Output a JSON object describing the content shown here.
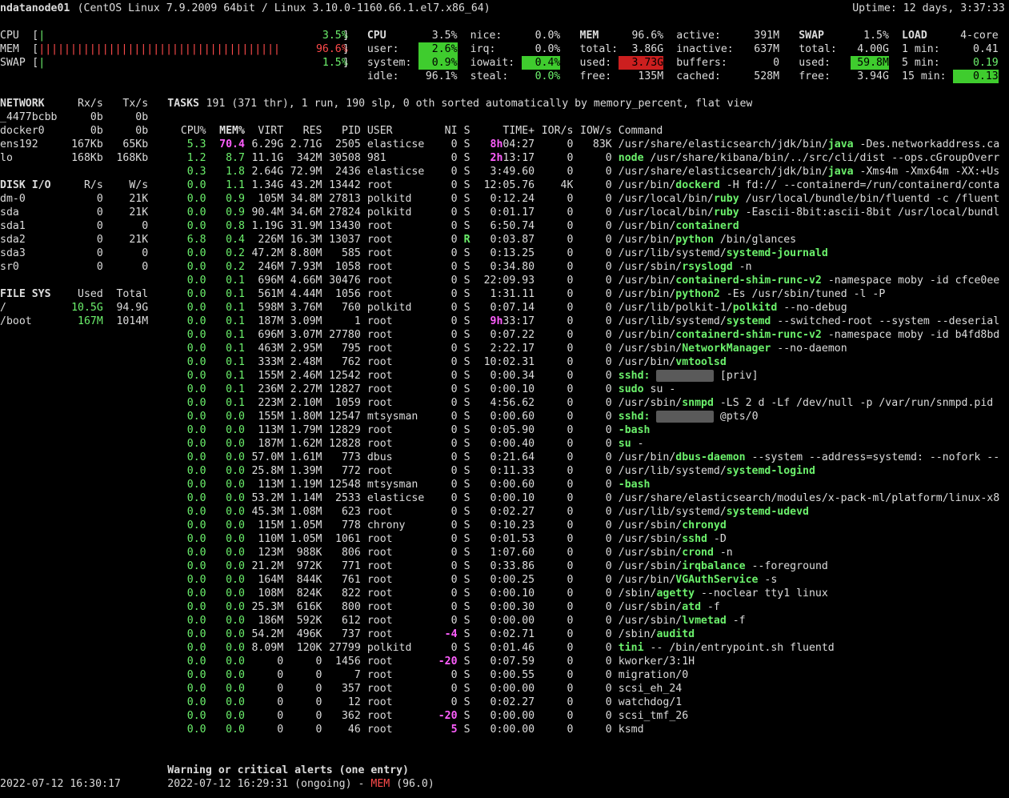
{
  "header": {
    "hostname": "ndatanode01",
    "system": "(CentOS Linux 7.9.2009 64bit / Linux 3.10.0-1160.66.1.el7.x86_64)",
    "uptime": "Uptime: 12 days, 3:37:33"
  },
  "quicklook": {
    "cpu": {
      "label": "CPU",
      "bar": "|",
      "value": "3.5%",
      "percent": 3.5
    },
    "mem": {
      "label": "MEM",
      "bar": "||||||||||||||||||||||||||||||||||||||",
      "value": "96.6%",
      "percent": 96.6
    },
    "swap": {
      "label": "SWAP",
      "bar": "|",
      "value": "1.5%",
      "percent": 1.5
    }
  },
  "cpu": {
    "title": "CPU",
    "total": "3.5%",
    "user_label": "user:",
    "user": "2.6%",
    "system_label": "system:",
    "system": "0.9%",
    "idle_label": "idle:",
    "idle": "96.1%",
    "nice_label": "nice:",
    "nice": "0.0%",
    "irq_label": "irq:",
    "irq": "0.0%",
    "iowait_label": "iowait:",
    "iowait": "0.4%",
    "steal_label": "steal:",
    "steal": "0.0%"
  },
  "mem": {
    "title": "MEM",
    "percent": "96.6%",
    "total_label": "total:",
    "total": "3.86G",
    "used_label": "used:",
    "used": "3.73G",
    "free_label": "free:",
    "free": "135M",
    "active_label": "active:",
    "active": "391M",
    "inactive_label": "inactive:",
    "inactive": "637M",
    "buffers_label": "buffers:",
    "buffers": "0",
    "cached_label": "cached:",
    "cached": "528M"
  },
  "swap": {
    "title": "SWAP",
    "percent": "1.5%",
    "total_label": "total:",
    "total": "4.00G",
    "used_label": "used:",
    "used": "59.8M",
    "free_label": "free:",
    "free": "3.94G"
  },
  "load": {
    "title": "LOAD",
    "cores": "4-core",
    "l1_label": "1 min:",
    "l1": "0.41",
    "l5_label": "5 min:",
    "l5": "0.19",
    "l15_label": "15 min:",
    "l15": "0.13"
  },
  "network": {
    "title": "NETWORK",
    "rx_header": "Rx/s",
    "tx_header": "Tx/s",
    "rows": [
      {
        "name": "_4477bcbb",
        "rx": "0b",
        "tx": "0b"
      },
      {
        "name": "docker0",
        "rx": "0b",
        "tx": "0b"
      },
      {
        "name": "ens192",
        "rx": "167Kb",
        "tx": "65Kb"
      },
      {
        "name": "lo",
        "rx": "168Kb",
        "tx": "168Kb"
      }
    ]
  },
  "diskio": {
    "title": "DISK I/O",
    "r_header": "R/s",
    "w_header": "W/s",
    "rows": [
      {
        "name": "dm-0",
        "r": "0",
        "w": "21K"
      },
      {
        "name": "sda",
        "r": "0",
        "w": "21K"
      },
      {
        "name": "sda1",
        "r": "0",
        "w": "0"
      },
      {
        "name": "sda2",
        "r": "0",
        "w": "21K"
      },
      {
        "name": "sda3",
        "r": "0",
        "w": "0"
      },
      {
        "name": "sr0",
        "r": "0",
        "w": "0"
      }
    ]
  },
  "fs": {
    "title": "FILE SYS",
    "used_header": "Used",
    "total_header": "Total",
    "rows": [
      {
        "name": "/",
        "used": "10.5G",
        "total": "94.9G"
      },
      {
        "name": "/boot",
        "used": "167M",
        "total": "1014M"
      }
    ]
  },
  "tasks": {
    "title": "TASKS",
    "summary": "191 (371 thr), 1 run, 190 slp, 0 oth sorted automatically by memory_percent, flat view"
  },
  "proc_headers": {
    "cpu": "CPU%",
    "mem": "MEM%",
    "virt": "VIRT",
    "res": "RES",
    "pid": "PID",
    "user": "USER",
    "ni": "NI",
    "s": "S",
    "time": "TIME+",
    "ior": "IOR/s",
    "iow": "IOW/s",
    "cmd": "Command"
  },
  "processes": [
    {
      "cpu": "5.3",
      "mem": "70.4",
      "virt": "6.29G",
      "res": "2.71G",
      "pid": "2505",
      "user": "elasticse",
      "ni": "0",
      "s": "S",
      "time_hi": "8h",
      "time": "04:27",
      "ior": "0",
      "iow": "83K",
      "cmd_pre": "/usr/share/elasticsearch/jdk/bin/",
      "cmd_hl": "java",
      "cmd_post": " -Des.networkaddress.ca"
    },
    {
      "cpu": "1.2",
      "mem": "8.7",
      "virt": "11.1G",
      "res": "342M",
      "pid": "30508",
      "user": "981",
      "ni": "0",
      "s": "S",
      "time_hi": "2h",
      "time": "13:17",
      "ior": "0",
      "iow": "0",
      "cmd_pre": "",
      "cmd_hl": "node",
      "cmd_post": " /usr/share/kibana/bin/../src/cli/dist --ops.cGroupOverr"
    },
    {
      "cpu": "0.3",
      "mem": "1.8",
      "virt": "2.64G",
      "res": "72.9M",
      "pid": "2436",
      "user": "elasticse",
      "ni": "0",
      "s": "S",
      "time_hi": "",
      "time": "3:49.60",
      "ior": "0",
      "iow": "0",
      "cmd_pre": "/usr/share/elasticsearch/jdk/bin/",
      "cmd_hl": "java",
      "cmd_post": " -Xms4m -Xmx64m -XX:+Us"
    },
    {
      "cpu": "0.0",
      "mem": "1.1",
      "virt": "1.34G",
      "res": "43.2M",
      "pid": "13442",
      "user": "root",
      "ni": "0",
      "s": "S",
      "time_hi": "",
      "time": "12:05.76",
      "ior": "4K",
      "iow": "0",
      "cmd_pre": "/usr/bin/",
      "cmd_hl": "dockerd",
      "cmd_post": " -H fd:// --containerd=/run/containerd/conta"
    },
    {
      "cpu": "0.0",
      "mem": "0.9",
      "virt": "105M",
      "res": "34.8M",
      "pid": "27813",
      "user": "polkitd",
      "ni": "0",
      "s": "S",
      "time_hi": "",
      "time": "0:12.24",
      "ior": "0",
      "iow": "0",
      "cmd_pre": "/usr/local/bin/",
      "cmd_hl": "ruby",
      "cmd_post": " /usr/local/bundle/bin/fluentd -c /fluent"
    },
    {
      "cpu": "0.0",
      "mem": "0.9",
      "virt": "90.4M",
      "res": "34.6M",
      "pid": "27824",
      "user": "polkitd",
      "ni": "0",
      "s": "S",
      "time_hi": "",
      "time": "0:01.17",
      "ior": "0",
      "iow": "0",
      "cmd_pre": "/usr/local/bin/",
      "cmd_hl": "ruby",
      "cmd_post": " -Eascii-8bit:ascii-8bit /usr/local/bundl"
    },
    {
      "cpu": "0.0",
      "mem": "0.8",
      "virt": "1.19G",
      "res": "31.9M",
      "pid": "13430",
      "user": "root",
      "ni": "0",
      "s": "S",
      "time_hi": "",
      "time": "6:50.74",
      "ior": "0",
      "iow": "0",
      "cmd_pre": "/usr/bin/",
      "cmd_hl": "containerd",
      "cmd_post": ""
    },
    {
      "cpu": "6.8",
      "mem": "0.4",
      "virt": "226M",
      "res": "16.3M",
      "pid": "13037",
      "user": "root",
      "ni": "0",
      "s": "R",
      "time_hi": "",
      "time": "0:03.87",
      "ior": "0",
      "iow": "0",
      "cmd_pre": "/usr/bin/",
      "cmd_hl": "python",
      "cmd_post": " /bin/glances"
    },
    {
      "cpu": "0.0",
      "mem": "0.2",
      "virt": "47.2M",
      "res": "8.80M",
      "pid": "585",
      "user": "root",
      "ni": "0",
      "s": "S",
      "time_hi": "",
      "time": "0:13.25",
      "ior": "0",
      "iow": "0",
      "cmd_pre": "/usr/lib/systemd/",
      "cmd_hl": "systemd-journald",
      "cmd_post": ""
    },
    {
      "cpu": "0.0",
      "mem": "0.2",
      "virt": "246M",
      "res": "7.93M",
      "pid": "1058",
      "user": "root",
      "ni": "0",
      "s": "S",
      "time_hi": "",
      "time": "0:34.80",
      "ior": "0",
      "iow": "0",
      "cmd_pre": "/usr/sbin/",
      "cmd_hl": "rsyslogd",
      "cmd_post": " -n"
    },
    {
      "cpu": "0.0",
      "mem": "0.1",
      "virt": "696M",
      "res": "4.66M",
      "pid": "30476",
      "user": "root",
      "ni": "0",
      "s": "S",
      "time_hi": "",
      "time": "22:09.93",
      "ior": "0",
      "iow": "0",
      "cmd_pre": "/usr/bin/",
      "cmd_hl": "containerd-shim-runc-v2",
      "cmd_post": " -namespace moby -id cfce0ee"
    },
    {
      "cpu": "0.0",
      "mem": "0.1",
      "virt": "561M",
      "res": "4.44M",
      "pid": "1056",
      "user": "root",
      "ni": "0",
      "s": "S",
      "time_hi": "",
      "time": "1:31.11",
      "ior": "0",
      "iow": "0",
      "cmd_pre": "/usr/bin/",
      "cmd_hl": "python2",
      "cmd_post": " -Es /usr/sbin/tuned -l -P"
    },
    {
      "cpu": "0.0",
      "mem": "0.1",
      "virt": "598M",
      "res": "3.76M",
      "pid": "760",
      "user": "polkitd",
      "ni": "0",
      "s": "S",
      "time_hi": "",
      "time": "0:07.14",
      "ior": "0",
      "iow": "0",
      "cmd_pre": "/usr/lib/polkit-1/",
      "cmd_hl": "polkitd",
      "cmd_post": " --no-debug"
    },
    {
      "cpu": "0.0",
      "mem": "0.1",
      "virt": "187M",
      "res": "3.09M",
      "pid": "1",
      "user": "root",
      "ni": "0",
      "s": "S",
      "time_hi": "9h",
      "time": "33:17",
      "ior": "0",
      "iow": "0",
      "cmd_pre": "/usr/lib/systemd/",
      "cmd_hl": "systemd",
      "cmd_post": " --switched-root --system --deserial"
    },
    {
      "cpu": "0.0",
      "mem": "0.1",
      "virt": "696M",
      "res": "3.07M",
      "pid": "27780",
      "user": "root",
      "ni": "0",
      "s": "S",
      "time_hi": "",
      "time": "0:07.22",
      "ior": "0",
      "iow": "0",
      "cmd_pre": "/usr/bin/",
      "cmd_hl": "containerd-shim-runc-v2",
      "cmd_post": " -namespace moby -id b4fd8bd"
    },
    {
      "cpu": "0.0",
      "mem": "0.1",
      "virt": "463M",
      "res": "2.95M",
      "pid": "795",
      "user": "root",
      "ni": "0",
      "s": "S",
      "time_hi": "",
      "time": "2:22.17",
      "ior": "0",
      "iow": "0",
      "cmd_pre": "/usr/sbin/",
      "cmd_hl": "NetworkManager",
      "cmd_post": " --no-daemon"
    },
    {
      "cpu": "0.0",
      "mem": "0.1",
      "virt": "333M",
      "res": "2.48M",
      "pid": "762",
      "user": "root",
      "ni": "0",
      "s": "S",
      "time_hi": "",
      "time": "10:02.31",
      "ior": "0",
      "iow": "0",
      "cmd_pre": "/usr/bin/",
      "cmd_hl": "vmtoolsd",
      "cmd_post": ""
    },
    {
      "cpu": "0.0",
      "mem": "0.1",
      "virt": "155M",
      "res": "2.46M",
      "pid": "12542",
      "user": "root",
      "ni": "0",
      "s": "S",
      "time_hi": "",
      "time": "0:00.34",
      "ior": "0",
      "iow": "0",
      "cmd_pre": "",
      "cmd_hl": "sshd:",
      "cmd_blur": "xxxxxxxxx",
      "cmd_post": "[priv]"
    },
    {
      "cpu": "0.0",
      "mem": "0.1",
      "virt": "236M",
      "res": "2.27M",
      "pid": "12827",
      "user": "root",
      "ni": "0",
      "s": "S",
      "time_hi": "",
      "time": "0:00.10",
      "ior": "0",
      "iow": "0",
      "cmd_pre": "",
      "cmd_hl": "sudo",
      "cmd_post": " su -"
    },
    {
      "cpu": "0.0",
      "mem": "0.1",
      "virt": "223M",
      "res": "2.10M",
      "pid": "1059",
      "user": "root",
      "ni": "0",
      "s": "S",
      "time_hi": "",
      "time": "4:56.62",
      "ior": "0",
      "iow": "0",
      "cmd_pre": "/usr/sbin/",
      "cmd_hl": "snmpd",
      "cmd_post": " -LS 2 d -Lf /dev/null -p /var/run/snmpd.pid"
    },
    {
      "cpu": "0.0",
      "mem": "0.0",
      "virt": "155M",
      "res": "1.80M",
      "pid": "12547",
      "user": "mtsysman",
      "ni": "0",
      "s": "S",
      "time_hi": "",
      "time": "0:00.60",
      "ior": "0",
      "iow": "0",
      "cmd_pre": "",
      "cmd_hl": "sshd:",
      "cmd_blur": "xxxxxxxxx",
      "cmd_post": "@pts/0"
    },
    {
      "cpu": "0.0",
      "mem": "0.0",
      "virt": "113M",
      "res": "1.79M",
      "pid": "12829",
      "user": "root",
      "ni": "0",
      "s": "S",
      "time_hi": "",
      "time": "0:05.90",
      "ior": "0",
      "iow": "0",
      "cmd_pre": "",
      "cmd_hl": "-bash",
      "cmd_post": ""
    },
    {
      "cpu": "0.0",
      "mem": "0.0",
      "virt": "187M",
      "res": "1.62M",
      "pid": "12828",
      "user": "root",
      "ni": "0",
      "s": "S",
      "time_hi": "",
      "time": "0:00.40",
      "ior": "0",
      "iow": "0",
      "cmd_pre": "",
      "cmd_hl": "su",
      "cmd_post": " -"
    },
    {
      "cpu": "0.0",
      "mem": "0.0",
      "virt": "57.0M",
      "res": "1.61M",
      "pid": "773",
      "user": "dbus",
      "ni": "0",
      "s": "S",
      "time_hi": "",
      "time": "0:21.64",
      "ior": "0",
      "iow": "0",
      "cmd_pre": "/usr/bin/",
      "cmd_hl": "dbus-daemon",
      "cmd_post": " --system --address=systemd: --nofork --"
    },
    {
      "cpu": "0.0",
      "mem": "0.0",
      "virt": "25.8M",
      "res": "1.39M",
      "pid": "772",
      "user": "root",
      "ni": "0",
      "s": "S",
      "time_hi": "",
      "time": "0:11.33",
      "ior": "0",
      "iow": "0",
      "cmd_pre": "/usr/lib/systemd/",
      "cmd_hl": "systemd-logind",
      "cmd_post": ""
    },
    {
      "cpu": "0.0",
      "mem": "0.0",
      "virt": "113M",
      "res": "1.19M",
      "pid": "12548",
      "user": "mtsysman",
      "ni": "0",
      "s": "S",
      "time_hi": "",
      "time": "0:00.60",
      "ior": "0",
      "iow": "0",
      "cmd_pre": "",
      "cmd_hl": "-bash",
      "cmd_post": ""
    },
    {
      "cpu": "0.0",
      "mem": "0.0",
      "virt": "53.2M",
      "res": "1.14M",
      "pid": "2533",
      "user": "elasticse",
      "ni": "0",
      "s": "S",
      "time_hi": "",
      "time": "0:00.10",
      "ior": "0",
      "iow": "0",
      "cmd_pre": "/usr/share/elasticsearch/modules/x-pack-ml/platform/linux-x8",
      "cmd_hl": "",
      "cmd_post": ""
    },
    {
      "cpu": "0.0",
      "mem": "0.0",
      "virt": "45.3M",
      "res": "1.08M",
      "pid": "623",
      "user": "root",
      "ni": "0",
      "s": "S",
      "time_hi": "",
      "time": "0:02.27",
      "ior": "0",
      "iow": "0",
      "cmd_pre": "/usr/lib/systemd/",
      "cmd_hl": "systemd-udevd",
      "cmd_post": ""
    },
    {
      "cpu": "0.0",
      "mem": "0.0",
      "virt": "115M",
      "res": "1.05M",
      "pid": "778",
      "user": "chrony",
      "ni": "0",
      "s": "S",
      "time_hi": "",
      "time": "0:10.23",
      "ior": "0",
      "iow": "0",
      "cmd_pre": "/usr/sbin/",
      "cmd_hl": "chronyd",
      "cmd_post": ""
    },
    {
      "cpu": "0.0",
      "mem": "0.0",
      "virt": "110M",
      "res": "1.05M",
      "pid": "1061",
      "user": "root",
      "ni": "0",
      "s": "S",
      "time_hi": "",
      "time": "0:01.53",
      "ior": "0",
      "iow": "0",
      "cmd_pre": "/usr/sbin/",
      "cmd_hl": "sshd",
      "cmd_post": " -D"
    },
    {
      "cpu": "0.0",
      "mem": "0.0",
      "virt": "123M",
      "res": "988K",
      "pid": "806",
      "user": "root",
      "ni": "0",
      "s": "S",
      "time_hi": "",
      "time": "1:07.60",
      "ior": "0",
      "iow": "0",
      "cmd_pre": "/usr/sbin/",
      "cmd_hl": "crond",
      "cmd_post": " -n"
    },
    {
      "cpu": "0.0",
      "mem": "0.0",
      "virt": "21.2M",
      "res": "972K",
      "pid": "771",
      "user": "root",
      "ni": "0",
      "s": "S",
      "time_hi": "",
      "time": "0:33.86",
      "ior": "0",
      "iow": "0",
      "cmd_pre": "/usr/sbin/",
      "cmd_hl": "irqbalance",
      "cmd_post": " --foreground"
    },
    {
      "cpu": "0.0",
      "mem": "0.0",
      "virt": "164M",
      "res": "844K",
      "pid": "761",
      "user": "root",
      "ni": "0",
      "s": "S",
      "time_hi": "",
      "time": "0:00.25",
      "ior": "0",
      "iow": "0",
      "cmd_pre": "/usr/bin/",
      "cmd_hl": "VGAuthService",
      "cmd_post": " -s"
    },
    {
      "cpu": "0.0",
      "mem": "0.0",
      "virt": "108M",
      "res": "824K",
      "pid": "822",
      "user": "root",
      "ni": "0",
      "s": "S",
      "time_hi": "",
      "time": "0:00.10",
      "ior": "0",
      "iow": "0",
      "cmd_pre": "/sbin/",
      "cmd_hl": "agetty",
      "cmd_post": " --noclear tty1 linux"
    },
    {
      "cpu": "0.0",
      "mem": "0.0",
      "virt": "25.3M",
      "res": "616K",
      "pid": "800",
      "user": "root",
      "ni": "0",
      "s": "S",
      "time_hi": "",
      "time": "0:00.30",
      "ior": "0",
      "iow": "0",
      "cmd_pre": "/usr/sbin/",
      "cmd_hl": "atd",
      "cmd_post": " -f"
    },
    {
      "cpu": "0.0",
      "mem": "0.0",
      "virt": "186M",
      "res": "592K",
      "pid": "612",
      "user": "root",
      "ni": "0",
      "s": "S",
      "time_hi": "",
      "time": "0:00.00",
      "ior": "0",
      "iow": "0",
      "cmd_pre": "/usr/sbin/",
      "cmd_hl": "lvmetad",
      "cmd_post": " -f"
    },
    {
      "cpu": "0.0",
      "mem": "0.0",
      "virt": "54.2M",
      "res": "496K",
      "pid": "737",
      "user": "root",
      "ni": "-4",
      "s": "S",
      "time_hi": "",
      "time": "0:02.71",
      "ior": "0",
      "iow": "0",
      "cmd_pre": "/sbin/",
      "cmd_hl": "auditd",
      "cmd_post": ""
    },
    {
      "cpu": "0.0",
      "mem": "0.0",
      "virt": "8.09M",
      "res": "120K",
      "pid": "27799",
      "user": "polkitd",
      "ni": "0",
      "s": "S",
      "time_hi": "",
      "time": "0:01.46",
      "ior": "0",
      "iow": "0",
      "cmd_pre": "",
      "cmd_hl": "tini",
      "cmd_post": " -- /bin/entrypoint.sh fluentd"
    },
    {
      "cpu": "0.0",
      "mem": "0.0",
      "virt": "0",
      "res": "0",
      "pid": "1456",
      "user": "root",
      "ni": "-20",
      "s": "S",
      "time_hi": "",
      "time": "0:07.59",
      "ior": "0",
      "iow": "0",
      "cmd_pre": "kworker/3:1H",
      "cmd_hl": "",
      "cmd_post": ""
    },
    {
      "cpu": "0.0",
      "mem": "0.0",
      "virt": "0",
      "res": "0",
      "pid": "7",
      "user": "root",
      "ni": "0",
      "s": "S",
      "time_hi": "",
      "time": "0:00.55",
      "ior": "0",
      "iow": "0",
      "cmd_pre": "migration/0",
      "cmd_hl": "",
      "cmd_post": ""
    },
    {
      "cpu": "0.0",
      "mem": "0.0",
      "virt": "0",
      "res": "0",
      "pid": "357",
      "user": "root",
      "ni": "0",
      "s": "S",
      "time_hi": "",
      "time": "0:00.00",
      "ior": "0",
      "iow": "0",
      "cmd_pre": "scsi_eh_24",
      "cmd_hl": "",
      "cmd_post": ""
    },
    {
      "cpu": "0.0",
      "mem": "0.0",
      "virt": "0",
      "res": "0",
      "pid": "12",
      "user": "root",
      "ni": "0",
      "s": "S",
      "time_hi": "",
      "time": "0:02.27",
      "ior": "0",
      "iow": "0",
      "cmd_pre": "watchdog/1",
      "cmd_hl": "",
      "cmd_post": ""
    },
    {
      "cpu": "0.0",
      "mem": "0.0",
      "virt": "0",
      "res": "0",
      "pid": "362",
      "user": "root",
      "ni": "-20",
      "s": "S",
      "time_hi": "",
      "time": "0:00.00",
      "ior": "0",
      "iow": "0",
      "cmd_pre": "scsi_tmf_26",
      "cmd_hl": "",
      "cmd_post": ""
    },
    {
      "cpu": "0.0",
      "mem": "0.0",
      "virt": "0",
      "res": "0",
      "pid": "46",
      "user": "root",
      "ni": "5",
      "s": "S",
      "time_hi": "",
      "time": "0:00.00",
      "ior": "0",
      "iow": "0",
      "cmd_pre": "ksmd",
      "cmd_hl": "",
      "cmd_post": ""
    }
  ],
  "alerts": {
    "title": "Warning or critical alerts (one entry)",
    "entry_pre": "2022-07-12 16:29:31 (ongoing) - ",
    "entry_type": "MEM",
    "entry_post": " (96.0)"
  },
  "footer": {
    "datetime": "2022-07-12 16:30:17"
  },
  "colors": {
    "background": "#000000",
    "text": "#dcdcdc",
    "ok": "#6cf16c",
    "careful": "#ff5fff",
    "critical": "#ff4b4b",
    "ok_bg": "#3fcc2e",
    "critical_bg": "#cc1f1f"
  }
}
